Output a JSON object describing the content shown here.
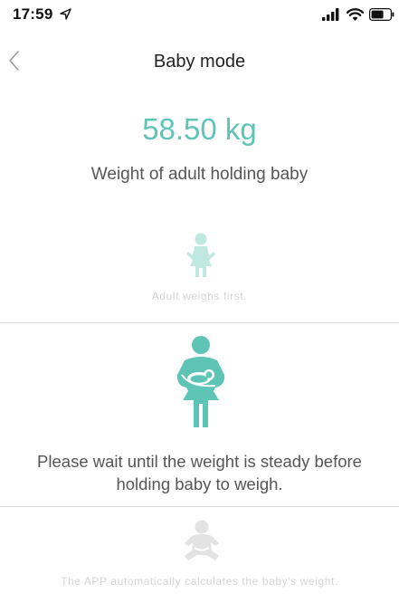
{
  "status_bar": {
    "time": "17:59",
    "icons": [
      "location-arrow-icon",
      "signal-icon",
      "wifi-icon",
      "battery-icon"
    ]
  },
  "nav": {
    "title": "Baby mode",
    "back_icon": "chevron-left-icon"
  },
  "weight": {
    "value": "58.50 kg",
    "caption": "Weight of adult holding baby"
  },
  "steps": [
    {
      "text": "Adult weighs first.",
      "icon": "adult-figure-icon",
      "state": "inactive"
    },
    {
      "text": "Please wait until the weight is steady before holding baby to weigh.",
      "icon": "adult-holding-baby-icon",
      "state": "active"
    },
    {
      "text": "The APP automatically calculates the baby's weight.",
      "icon": "baby-figure-icon",
      "state": "inactive"
    }
  ],
  "colors": {
    "accent": "#5ec4b6",
    "accent_faded": "#bfe8e1",
    "inactive_text": "#d4d4d4",
    "divider": "#d9d9d9"
  }
}
